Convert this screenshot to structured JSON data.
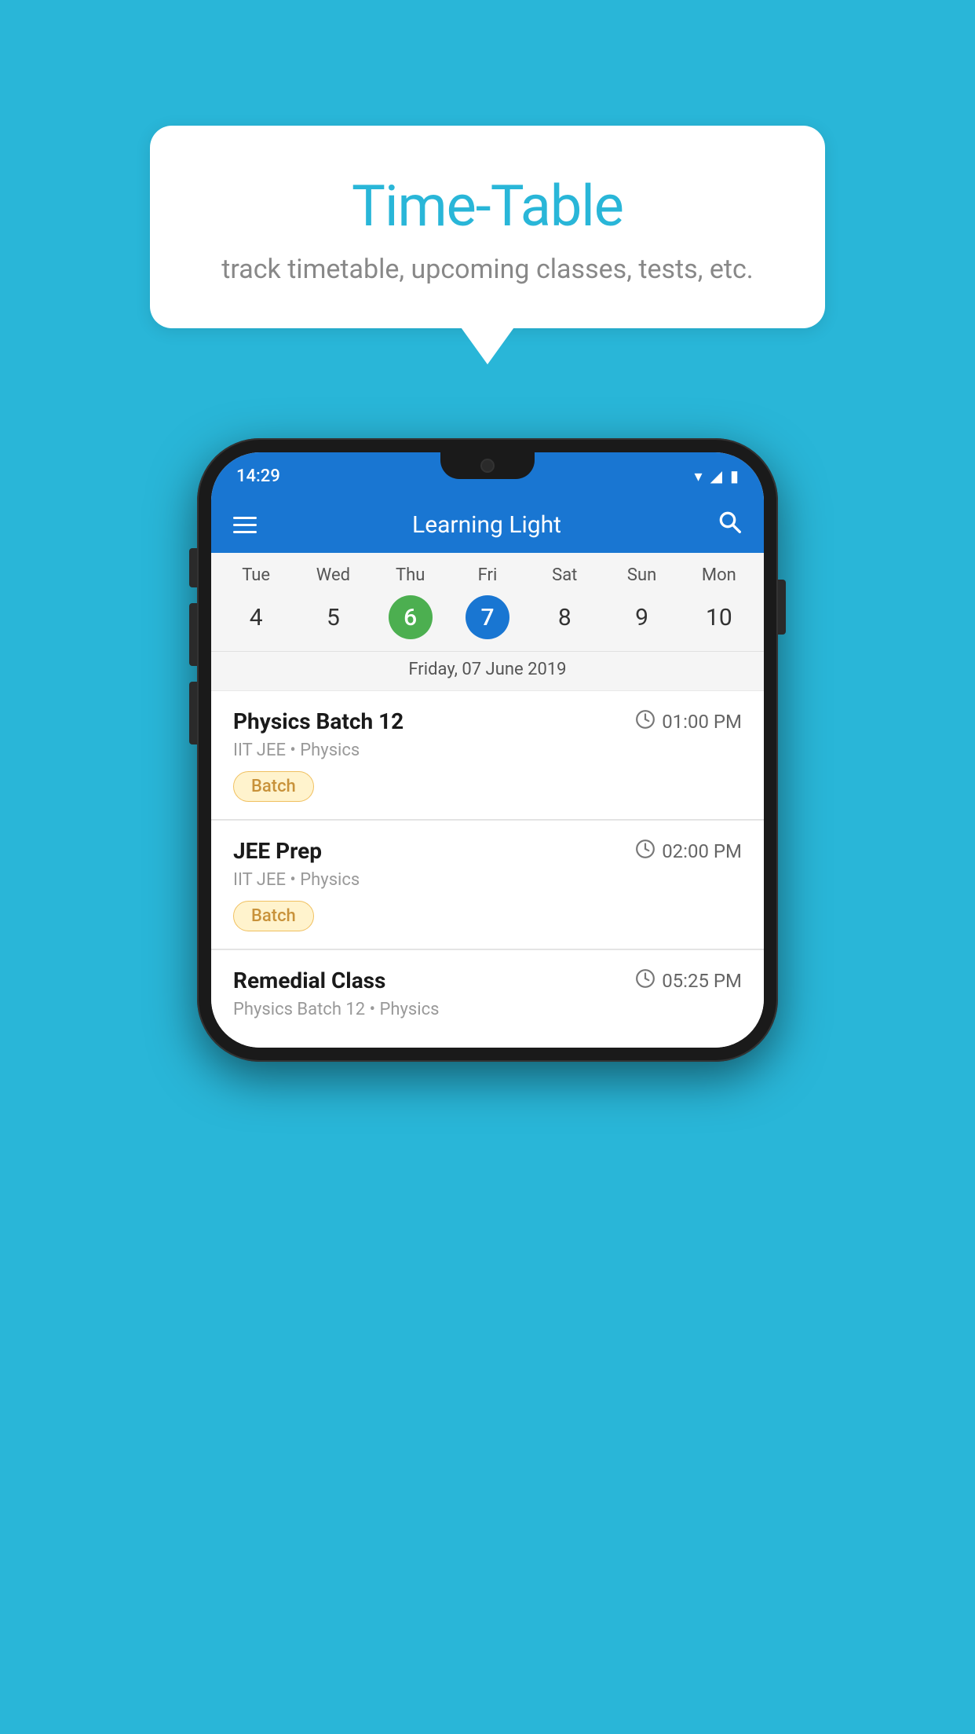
{
  "background_color": "#29b6d8",
  "bubble": {
    "title": "Time-Table",
    "subtitle": "track timetable, upcoming classes, tests, etc."
  },
  "phone": {
    "status_bar": {
      "time": "14:29"
    },
    "app_bar": {
      "title": "Learning Light"
    },
    "calendar": {
      "days": [
        {
          "short": "Tue",
          "num": "4"
        },
        {
          "short": "Wed",
          "num": "5"
        },
        {
          "short": "Thu",
          "num": "6",
          "state": "green"
        },
        {
          "short": "Fri",
          "num": "7",
          "state": "blue"
        },
        {
          "short": "Sat",
          "num": "8"
        },
        {
          "short": "Sun",
          "num": "9"
        },
        {
          "short": "Mon",
          "num": "10"
        }
      ],
      "selected_date": "Friday, 07 June 2019"
    },
    "schedule": [
      {
        "title": "Physics Batch 12",
        "time": "01:00 PM",
        "meta": "IIT JEE • Physics",
        "badge": "Batch"
      },
      {
        "title": "JEE Prep",
        "time": "02:00 PM",
        "meta": "IIT JEE • Physics",
        "badge": "Batch"
      },
      {
        "title": "Remedial Class",
        "time": "05:25 PM",
        "meta": "Physics Batch 12 • Physics",
        "badge": null
      }
    ]
  }
}
